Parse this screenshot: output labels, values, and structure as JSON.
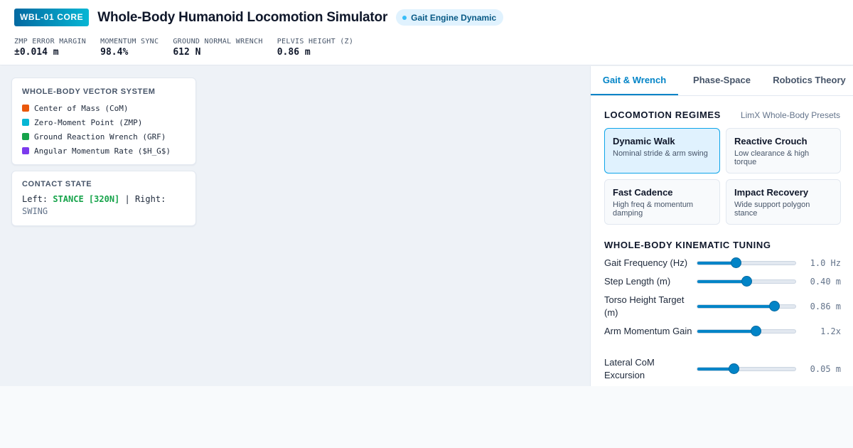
{
  "header": {
    "badge": "WBL-01 CORE",
    "title": "Whole-Body Humanoid Locomotion Simulator",
    "engine_status": "Gait Engine Dynamic",
    "metrics": [
      {
        "label": "ZMP ERROR MARGIN",
        "value": "±0.014 m"
      },
      {
        "label": "MOMENTUM SYNC",
        "value": "98.4%"
      },
      {
        "label": "GROUND NORMAL WRENCH",
        "value": "612 N"
      },
      {
        "label": "PELVIS HEIGHT (Z)",
        "value": "0.86 m"
      }
    ]
  },
  "legend": {
    "title": "WHOLE-BODY VECTOR SYSTEM",
    "items": [
      {
        "label": "Center of Mass (CoM)",
        "color": "#ea580c"
      },
      {
        "label": "Zero-Moment Point (ZMP)",
        "color": "#06b6d4"
      },
      {
        "label": "Ground Reaction Wrench (GRF)",
        "color": "#16a34a"
      },
      {
        "label": "Angular Momentum Rate ($H_G$)",
        "color": "#7c3aed"
      }
    ]
  },
  "contact": {
    "title": "CONTACT STATE",
    "left_prefix": "Left: ",
    "left_state": "STANCE [320N]",
    "separator": " | Right: ",
    "right_state": "SWING"
  },
  "panel": {
    "tabs": [
      {
        "label": "Gait & Wrench",
        "active": true
      },
      {
        "label": "Phase-Space",
        "active": false
      },
      {
        "label": "Robotics Theory",
        "active": false
      }
    ],
    "regimes": {
      "title": "LOCOMOTION REGIMES",
      "note": "LimX Whole-Body Presets",
      "presets": [
        {
          "title": "Dynamic Walk",
          "desc": "Nominal stride & arm swing",
          "active": true
        },
        {
          "title": "Reactive Crouch",
          "desc": "Low clearance & high torque",
          "active": false
        },
        {
          "title": "Fast Cadence",
          "desc": "High freq & momentum damping",
          "active": false
        },
        {
          "title": "Impact Recovery",
          "desc": "Wide support polygon stance",
          "active": false
        }
      ]
    },
    "tuning": {
      "title": "WHOLE-BODY KINEMATIC TUNING",
      "sliders": [
        {
          "label": "Gait Frequency (Hz)",
          "value": "1.0 Hz",
          "fraction": 0.39
        },
        {
          "label": "Step Length (m)",
          "value": "0.40 m",
          "fraction": 0.5
        },
        {
          "label": "Torso Height Target (m)",
          "value": "0.86 m",
          "fraction": 0.78
        },
        {
          "label": "Arm Momentum Gain",
          "value": "1.2x",
          "fraction": 0.59
        },
        {
          "label": "Lateral CoM Excursion",
          "value": "0.05 m",
          "fraction": 0.37
        }
      ]
    }
  }
}
